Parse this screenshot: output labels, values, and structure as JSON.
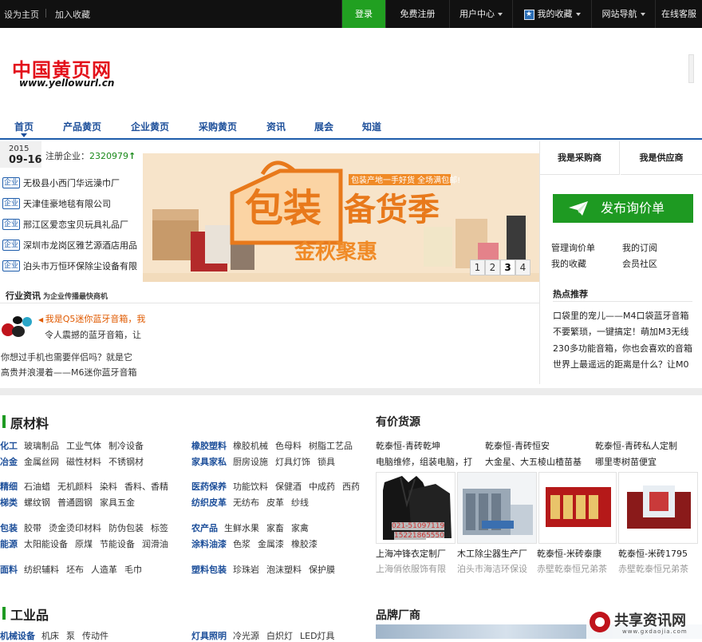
{
  "topbar": {
    "set_home": "设为主页",
    "add_fav": "加入收藏",
    "login": "登录",
    "register": "免费注册",
    "user_center": "用户中心",
    "my_favorites": "我的收藏",
    "site_nav": "网站导航",
    "online_service": "在线客服"
  },
  "logo": {
    "cn": "中国黄页网",
    "en": "www.yellowurl.cn"
  },
  "nav": [
    "首页",
    "产品黄页",
    "企业黄页",
    "采购黄页",
    "资讯",
    "展会",
    "知道"
  ],
  "left": {
    "year": "2015",
    "date": "09-16",
    "reg_label": "注册企业：",
    "reg_count": "2320979",
    "badge": "企业",
    "companies": [
      "无极县小西门华远澡巾厂",
      "天津佳豪地毯有限公司",
      "邢江区爱恋宝贝玩具礼品厂",
      "深圳市龙岗区雅艺源酒店用品",
      "泊头市万恒环保除尘设备有限"
    ]
  },
  "banner": {
    "pages": [
      "1",
      "2",
      "3",
      "4"
    ],
    "active_page": 3
  },
  "news": {
    "title": "行业资讯",
    "subtitle": "为企业传播最快商机",
    "headline": "我是Q5迷你蓝牙音箱，我",
    "headline2": "令人震撼的蓝牙音箱，让",
    "p1": "你想过手机也需要伴侣吗？就是它",
    "p2": "高贵并浪漫着——M6迷你蓝牙音箱"
  },
  "right": {
    "tab_buyer": "我是采购商",
    "tab_supplier": "我是供应商",
    "inquiry_button": "发布询价单",
    "links": [
      "管理询价单",
      "我的订阅",
      "我的收藏",
      "会员社区"
    ],
    "hot_title": "热点推荐",
    "hot_items": [
      "口袋里的宠儿——M4口袋蓝牙音箱",
      "不要繁琐，一键搞定！萌加M3无线",
      "230多功能音箱，你也会喜欢的音箱",
      "世界上最遥远的距离是什么？让M0"
    ]
  },
  "materials": {
    "title": "原材料",
    "rows": [
      {
        "key": "化工",
        "items": [
          "玻璃制品",
          "工业气体",
          "制冷设备"
        ]
      },
      {
        "key": "冶金",
        "items": [
          "金属丝网",
          "磁性材料",
          "不锈钢材"
        ]
      },
      {
        "key": "精细",
        "items": [
          "石油蜡",
          "无机颜料",
          "染料",
          "香料、香精"
        ]
      },
      {
        "key": "梯类",
        "items": [
          "螺纹钢",
          "普通圆钢",
          "家具五金"
        ]
      },
      {
        "key": "包装",
        "items": [
          "胶带",
          "烫金烫印材料",
          "防伪包装",
          "标签"
        ]
      },
      {
        "key": "能源",
        "items": [
          "太阳能设备",
          "原煤",
          "节能设备",
          "润滑油"
        ]
      },
      {
        "key": "面料",
        "items": [
          "纺织辅料",
          "坯布",
          "人造革",
          "毛巾"
        ]
      }
    ],
    "rows_right": [
      {
        "key": "橡胶塑料",
        "items": [
          "橡胶机械",
          "色母料",
          "树脂工艺品"
        ]
      },
      {
        "key": "家具家私",
        "items": [
          "厨房设施",
          "灯具灯饰",
          "锁具"
        ]
      },
      {
        "key": "医药保养",
        "items": [
          "功能饮料",
          "保健酒",
          "中成药",
          "西药"
        ]
      },
      {
        "key": "纺织皮革",
        "items": [
          "无纺布",
          "皮革",
          "纱线"
        ]
      },
      {
        "key": "农产品",
        "items": [
          "生鲜水果",
          "家畜",
          "家禽"
        ]
      },
      {
        "key": "涂料油漆",
        "items": [
          "色浆",
          "金属漆",
          "橡胶漆"
        ]
      },
      {
        "key": "塑料包装",
        "items": [
          "珍珠岩",
          "泡沫塑料",
          "保护膜"
        ]
      }
    ]
  },
  "goods": {
    "title": "有价货源",
    "links": [
      "乾泰恒-青砖乾坤",
      "乾泰恒-青砖恒安",
      "乾泰恒-青砖私人定制",
      "电脑维修，组装电脑，打",
      "大金星、大五棱山楂苗基",
      "哪里枣树苗便宜"
    ],
    "jacket_phone1": "021-51097119",
    "jacket_phone2": "15221865550",
    "captions": [
      "上海冲锋衣定制厂",
      "木工除尘器生产厂",
      "乾泰恒-米砖泰康",
      "乾泰恒-米砖1795"
    ],
    "captions2": [
      "上海俏依服饰有限",
      "泊头市海洁环保设",
      "赤壁乾泰恒兄弟茶",
      "赤壁乾泰恒兄弟茶"
    ]
  },
  "industrial": {
    "title": "工业品",
    "row1_key": "机械设备",
    "row1_items": [
      "机床",
      "泵",
      "传动件"
    ],
    "row1b_key": "灯具照明",
    "row1b_items": [
      "冷光源",
      "白炽灯",
      "LED灯具"
    ]
  },
  "brand": {
    "title": "品牌厂商"
  },
  "watermark": {
    "text": "共享资讯网",
    "sub": "www.gxdaojia.com"
  },
  "colors": {
    "green": "#1e9a22",
    "nav_blue": "#1d4f9a",
    "logo_red": "#e3101a"
  }
}
